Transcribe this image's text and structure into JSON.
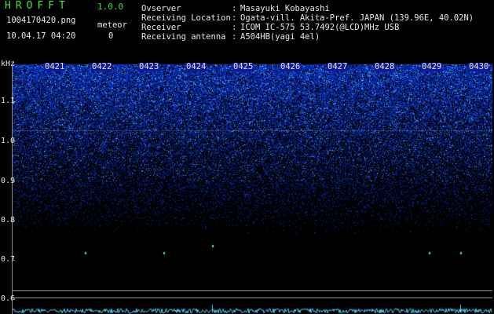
{
  "app": {
    "title": "HROFFT",
    "version": "1.0.0"
  },
  "file": {
    "name": "1004170420.png",
    "datetime": "10.04.17 04:20"
  },
  "meteor": {
    "label": "meteor",
    "count": "0"
  },
  "info": [
    {
      "label": "Ovserver",
      "value": "Masayuki Kobayashi"
    },
    {
      "label": "Receiving Location",
      "value": "Ogata-vill. Akita-Pref. JAPAN (139.96E, 40.02N)"
    },
    {
      "label": "Receiver",
      "value": "ICOM IC-575 53.7492(@LCD)MHz USB"
    },
    {
      "label": "Receiving antenna",
      "value": "A504HB(yagi 4el)"
    }
  ],
  "colon": ":",
  "yaxis": {
    "unit": "kHz",
    "ticks": [
      "1.1",
      "1.0",
      "0.9",
      "0.8",
      "0.7",
      "0.6"
    ]
  },
  "xaxis": {
    "time_labels": [
      "0421",
      "0422",
      "0423",
      "0424",
      "0425",
      "0426",
      "0427",
      "0428",
      "0429",
      "0430"
    ]
  },
  "colors": {
    "background": "#000000",
    "spectrogram_noise": "#1a33ff",
    "text": "#e8e8e8",
    "title": "#3fe03f",
    "signal": "#4fd6ff"
  }
}
